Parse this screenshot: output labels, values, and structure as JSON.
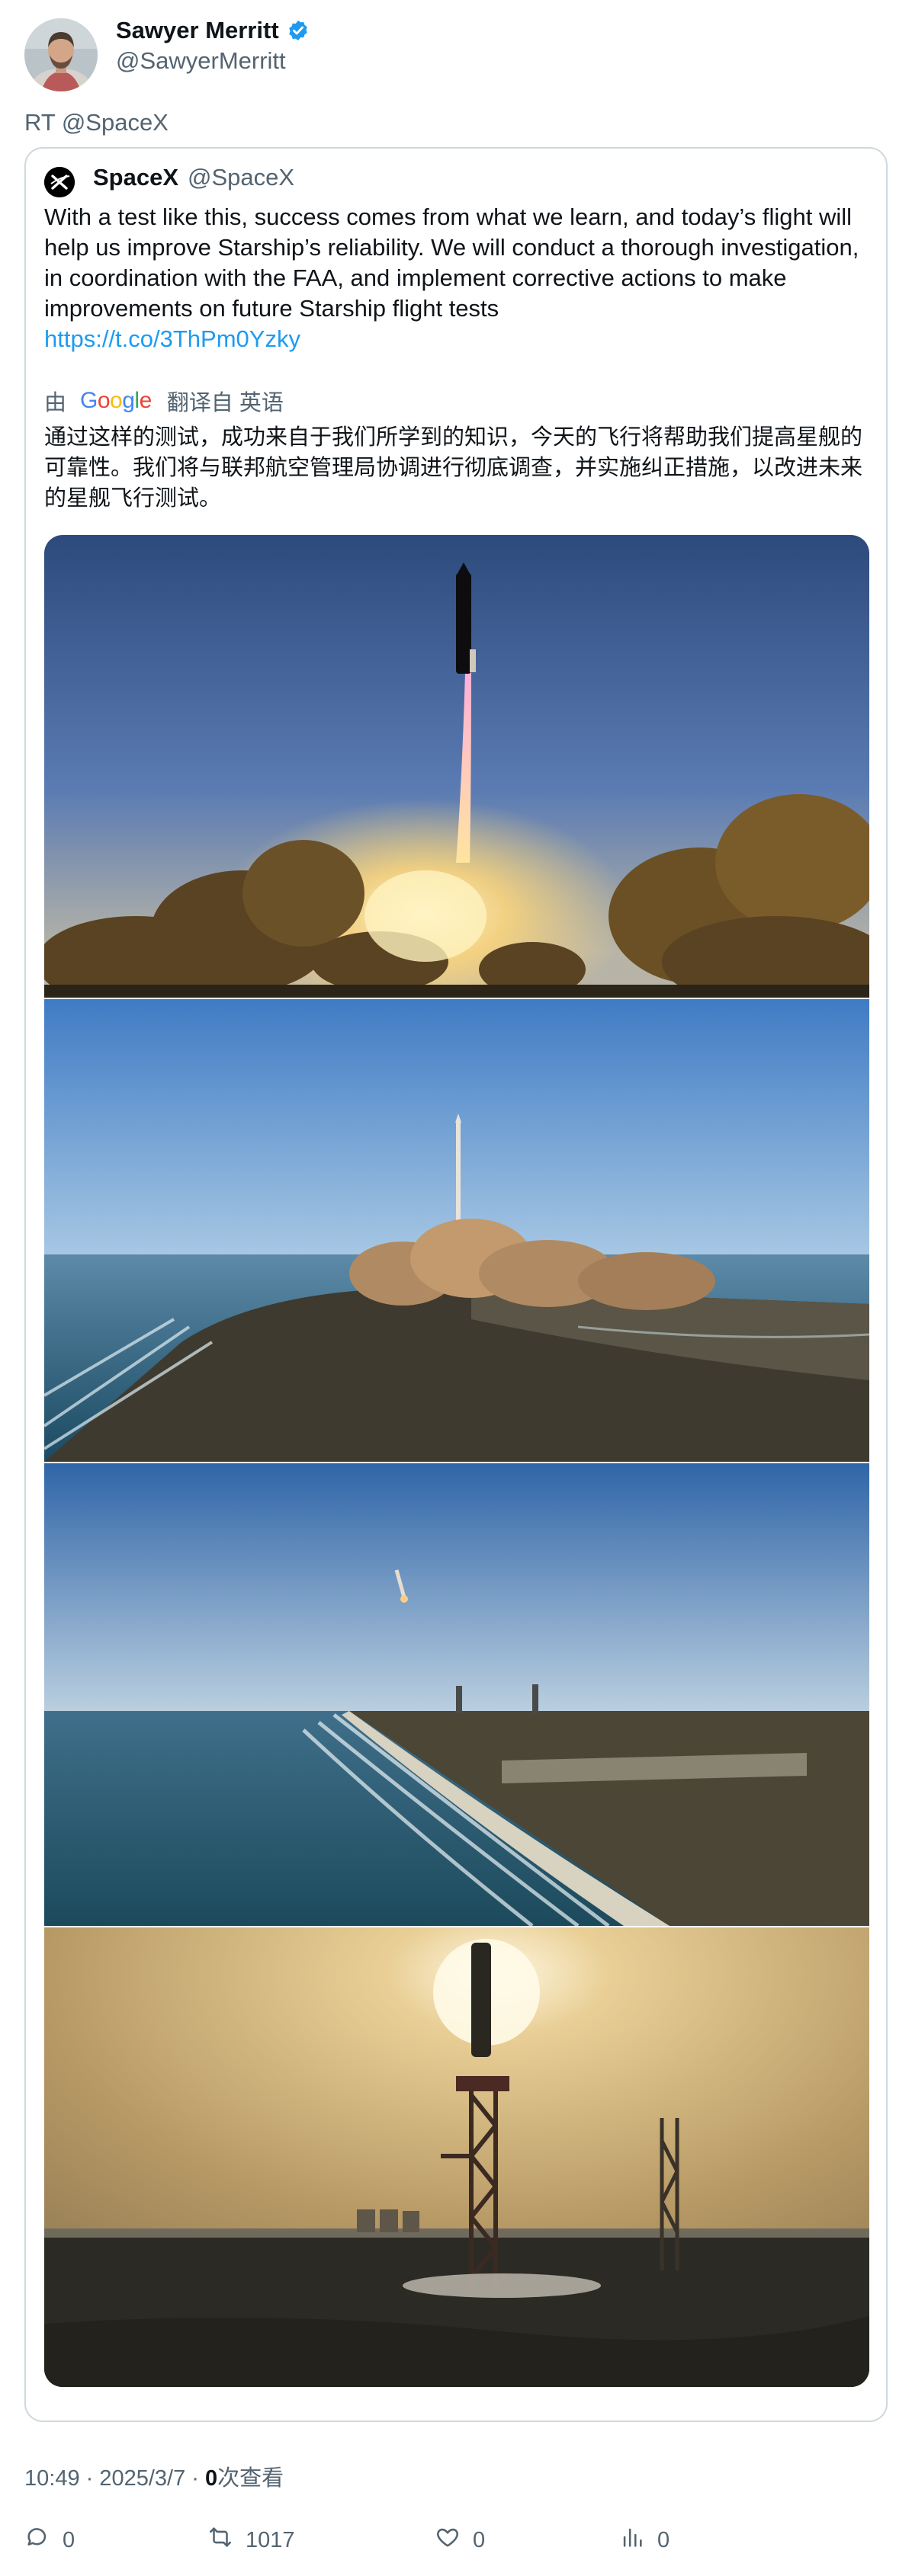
{
  "author": {
    "name": "Sawyer Merritt",
    "handle": "@SawyerMerritt"
  },
  "retweet_label": "RT @SpaceX",
  "quoted": {
    "name": "SpaceX",
    "handle": "@SpaceX",
    "text": "With a test like this, success comes from what we learn, and today’s flight will help us improve Starship’s reliability. We will conduct a thorough investigation, in coordination with the FAA, and implement corrective actions to make improvements on future Starship flight tests",
    "link": "https://t.co/3ThPm0Yzky",
    "translation": {
      "prefix": "由",
      "provider": "Google",
      "suffix": "翻译自 英语",
      "text": "通过这样的测试，成功来自于我们所学到的知识，今天的飞行将帮助我们提高星舰的可靠性。我们将与联邦航空管理局协调进行彻底调查，并实施纠正措施，以改进未来的星舰飞行测试。"
    }
  },
  "meta": {
    "time": "10:49 · 2025/3/7 · ",
    "views_count": "0",
    "views_label": "次查看"
  },
  "actions": {
    "reply_count": "0",
    "retweet_count": "1017",
    "like_count": "0",
    "views_count": "0"
  },
  "colors": {
    "link": "#1d9bf0",
    "secondary_text": "#536471",
    "verified": "#1d9bf0",
    "border": "#cfd9de"
  },
  "icons": [
    "verified-badge-icon",
    "spacex-logo-icon",
    "reply-icon",
    "retweet-icon",
    "like-icon",
    "views-icon"
  ]
}
